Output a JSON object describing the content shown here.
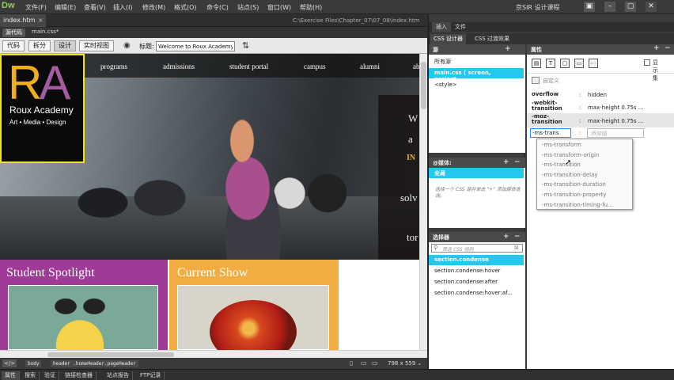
{
  "app": {
    "logo": "Dw",
    "menu": [
      "文件(F)",
      "编辑(E)",
      "查看(V)",
      "插入(I)",
      "修改(M)",
      "格式(O)",
      "命令(C)",
      "站点(S)",
      "窗口(W)",
      "帮助(H)"
    ],
    "user_label": "京SIR 设计课程",
    "window_buttons": [
      "▣",
      "–",
      "▢",
      "✕"
    ]
  },
  "document": {
    "tab": "index.htm",
    "tab_close": "×",
    "path": "C:\\Exercise Files\\Chapter_07\\07_08\\index.htm",
    "source_code": "源代码",
    "related_file": "main.css*"
  },
  "view_toolbar": {
    "buttons": [
      "代码",
      "拆分",
      "设计",
      "实时视图"
    ],
    "active": "设计",
    "live_icon": "◉",
    "title_label": "标题:",
    "title_value": "Welcome to Roux Academy",
    "check_icon": "⇅"
  },
  "page": {
    "nav": [
      "programs",
      "admissions",
      "student portal",
      "campus",
      "alumni",
      "ab"
    ],
    "logo_r": "R",
    "logo_a": "A",
    "logo_name": "Roux Academy",
    "logo_tag": "Art • Media • Design",
    "welcome_lines": [
      "W",
      "a",
      "IN",
      "solv",
      "tor"
    ],
    "spotlight_title": "Student Spotlight",
    "show_title": "Current Show"
  },
  "tag_selector": {
    "code_icon": "</>",
    "tags": [
      "body",
      "header .homeHeader.pageHeader"
    ],
    "icons": [
      "▯",
      "▭",
      "▭"
    ],
    "size": "798 x 559 ⌄"
  },
  "bottom_tabs": [
    "属性",
    "搜索",
    "验证",
    "链接检查器",
    "站点报告",
    "FTP记录"
  ],
  "right_panel": {
    "top_tabs": [
      "插入",
      "文件"
    ],
    "css_tabs": [
      "CSS 设计器",
      "CSS 过渡效果"
    ],
    "sources_title": "源",
    "sources": [
      "所有源",
      "main.css ( screen, project...",
      "<style>"
    ],
    "media_title": "@媒体:",
    "media_items": [
      "全局"
    ],
    "media_hint": "选择一个 CSS 源并单击 \"+\" 添加媒体查询。",
    "selectors_title": "选择器",
    "selector_search": "筛选 CSS 规则",
    "selectors": [
      "section.condense",
      "section.condense:hover",
      "section.condense:after",
      "section.condense:hover:af..."
    ],
    "properties_title": "属性",
    "plus": "+",
    "minus": "−",
    "show_set": "显示集",
    "custom_label": "自定义",
    "props": [
      {
        "name": "overflow",
        "value": "hidden"
      },
      {
        "name": "-webkit-\ntransition",
        "value": "max-height 0.75s ..."
      },
      {
        "name": "-moz-\ntransition",
        "value": "max-height 0.75s ..."
      }
    ],
    "editing": {
      "name": "-ms-trans",
      "placeholder": "添加值"
    },
    "hints": [
      "-ms-transform",
      "-ms-transform-origin",
      "-ms-transition",
      "-ms-transition-delay",
      "-ms-transition-duration",
      "-ms-transition-property",
      "-ms-transition-timing-fu..."
    ]
  },
  "colors": {
    "accent": "#25c7ef",
    "spotlight": "#9f3a96",
    "show": "#f2ad41",
    "logo_border": "#f2e51d"
  }
}
